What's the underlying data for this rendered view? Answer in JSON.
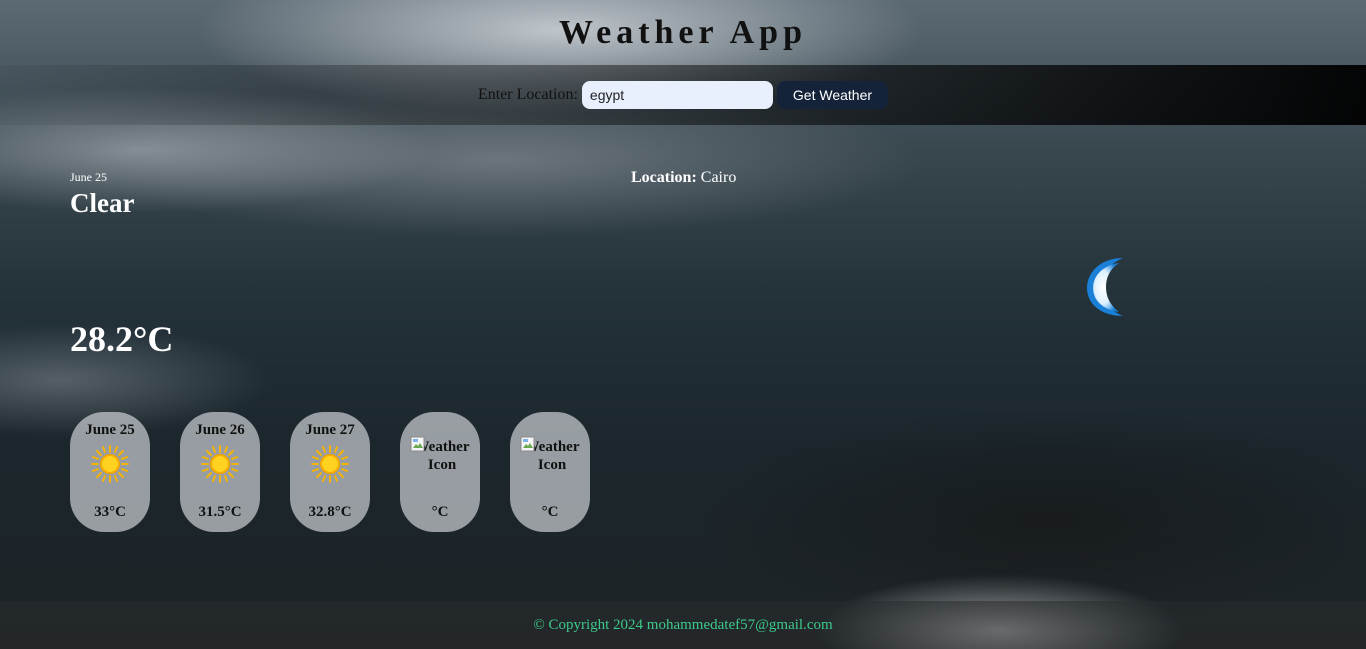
{
  "header": {
    "title": "Weather App"
  },
  "search": {
    "label": "Enter Location:",
    "value": "egypt",
    "button_label": "Get Weather"
  },
  "current": {
    "date": "June 25",
    "condition": "Clear",
    "location_label": "Location:",
    "location": "Cairo",
    "temperature": "28.2°C",
    "icon": "moon-icon"
  },
  "forecast": [
    {
      "date": "June 25",
      "icon": "sun-icon",
      "temp": "33°C"
    },
    {
      "date": "June 26",
      "icon": "sun-icon",
      "temp": "31.5°C"
    },
    {
      "date": "June 27",
      "icon": "sun-icon",
      "temp": "32.8°C"
    },
    {
      "date": "",
      "icon": "broken-image-icon",
      "icon_alt": "Weather Icon",
      "temp": "°C"
    },
    {
      "date": "",
      "icon": "broken-image-icon",
      "icon_alt": "Weather Icon",
      "temp": "°C"
    }
  ],
  "footer": {
    "copyright": "© Copyright 2024 mohammedatef57@gmail.com"
  },
  "colors": {
    "button_bg": "#14233a",
    "input_bg": "#e8f0fe",
    "footer_text": "#3ec98c",
    "moon_blue": "#1a7fd6"
  }
}
